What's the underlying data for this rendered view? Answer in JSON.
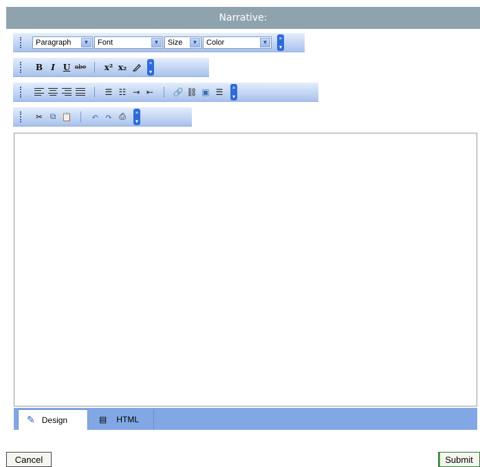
{
  "header": {
    "title": "Narrative:"
  },
  "toolbar1": {
    "paragraph": "Paragraph",
    "font": "Font",
    "size": "Size",
    "color": "Color"
  },
  "toolbar2": {
    "bold": "B",
    "italic": "I",
    "underline": "U",
    "strike": "abe",
    "superscript": "x²",
    "subscript": "x₂"
  },
  "tabs": {
    "design": "Design",
    "html": "HTML"
  },
  "buttons": {
    "cancel": "Cancel",
    "submit": "Submit"
  },
  "icons": [
    "toolbar-grip-icon",
    "expand-toolbar-icon",
    "eraser-icon",
    "align-left-icon",
    "align-center-icon",
    "align-right-icon",
    "justify-icon",
    "bullet-list-icon",
    "numbered-list-icon",
    "indent-icon",
    "outdent-icon",
    "insert-link-icon",
    "remove-link-icon",
    "insert-image-icon",
    "horizontal-rule-icon",
    "cut-icon",
    "copy-icon",
    "paste-icon",
    "undo-icon",
    "redo-icon",
    "print-icon",
    "design-mode-icon",
    "html-mode-icon"
  ],
  "colors": {
    "header": "#8fa3ae",
    "modebar": "#81a8e4",
    "toolbar": "#c3d6f3"
  }
}
